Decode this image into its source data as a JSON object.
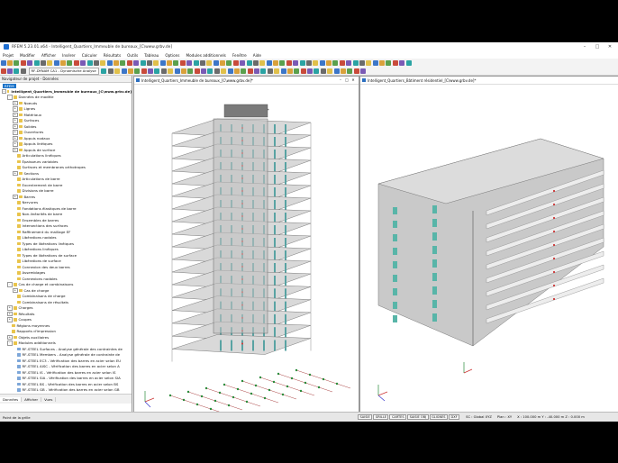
{
  "window": {
    "title": "RFEM 5.23.01.x64 - Intelligent_Quartiers_Immeuble de bureaux_[C\\www.grbv.de]",
    "controls": [
      "–",
      "□",
      "✕"
    ]
  },
  "menu": [
    "Projet",
    "Modifier",
    "Afficher",
    "Insérer",
    "Calculer",
    "Résultats",
    "Outils",
    "Tableau",
    "Options",
    "Modules additionnels",
    "Fenêtre",
    "Aide"
  ],
  "toolbar": {
    "load_case_combo": "RF-DYNAM CA1 - Dynamische Analyse",
    "colors": [
      "#3c76c8",
      "#d9a13b",
      "#5aa04d",
      "#c94b3b",
      "#7a5ab5",
      "#2aa3a3",
      "#6b6b6b",
      "#e0c04a"
    ]
  },
  "navigator": {
    "title": "Navigateur de projet - Données",
    "chip": "RFEM",
    "items": [
      {
        "depth": 0,
        "exp": "-",
        "label": "Intelligent_Quartiers_Immeuble de bureaux_[C\\www.grbv.de]",
        "bold": true
      },
      {
        "depth": 1,
        "exp": "-",
        "label": "Données de modèle"
      },
      {
        "depth": 2,
        "exp": "+",
        "label": "Noeuds"
      },
      {
        "depth": 2,
        "exp": "+",
        "label": "Lignes"
      },
      {
        "depth": 2,
        "exp": "+",
        "label": "Matériaux"
      },
      {
        "depth": 2,
        "exp": "+",
        "label": "Surfaces"
      },
      {
        "depth": 2,
        "exp": "+",
        "label": "Solides"
      },
      {
        "depth": 2,
        "exp": "+",
        "label": "Ouvertures"
      },
      {
        "depth": 2,
        "exp": "+",
        "label": "Appuis nodaux"
      },
      {
        "depth": 2,
        "exp": "+",
        "label": "Appuis linéiques"
      },
      {
        "depth": 2,
        "exp": "+",
        "label": "Appuis de surface"
      },
      {
        "depth": 2,
        "exp": "",
        "label": "Articulations linéiques"
      },
      {
        "depth": 2,
        "exp": "",
        "label": "Épaisseurs variables"
      },
      {
        "depth": 2,
        "exp": "",
        "label": "Surfaces et membranes orthotropes"
      },
      {
        "depth": 2,
        "exp": "+",
        "label": "Sections"
      },
      {
        "depth": 2,
        "exp": "",
        "label": "Articulations de barre"
      },
      {
        "depth": 2,
        "exp": "",
        "label": "Excentrement de barre"
      },
      {
        "depth": 2,
        "exp": "",
        "label": "Divisions de barre"
      },
      {
        "depth": 2,
        "exp": "+",
        "label": "Barres"
      },
      {
        "depth": 2,
        "exp": "",
        "label": "Nervures"
      },
      {
        "depth": 2,
        "exp": "",
        "label": "Fondations élastiques de barre"
      },
      {
        "depth": 2,
        "exp": "",
        "label": "Non-linéarités de barre"
      },
      {
        "depth": 2,
        "exp": "",
        "label": "Ensembles de barres"
      },
      {
        "depth": 2,
        "exp": "",
        "label": "Intersections des surfaces"
      },
      {
        "depth": 2,
        "exp": "",
        "label": "Raffinement du maillage EF"
      },
      {
        "depth": 2,
        "exp": "",
        "label": "Libérations nodales"
      },
      {
        "depth": 2,
        "exp": "",
        "label": "Types de libérations linéiques"
      },
      {
        "depth": 2,
        "exp": "",
        "label": "Libérations linéiques"
      },
      {
        "depth": 2,
        "exp": "",
        "label": "Types de libérations de surface"
      },
      {
        "depth": 2,
        "exp": "",
        "label": "Libérations de surface"
      },
      {
        "depth": 2,
        "exp": "",
        "label": "Connexion des deux barres"
      },
      {
        "depth": 2,
        "exp": "",
        "label": "Assemblages"
      },
      {
        "depth": 2,
        "exp": "",
        "label": "Connexions nodales"
      },
      {
        "depth": 1,
        "exp": "-",
        "label": "Cas de charge et combinaisons"
      },
      {
        "depth": 2,
        "exp": "+",
        "label": "Cas de charge"
      },
      {
        "depth": 2,
        "exp": "",
        "label": "Combinaisons de charge"
      },
      {
        "depth": 2,
        "exp": "",
        "label": "Combinaisons de résultats"
      },
      {
        "depth": 1,
        "exp": "+",
        "label": "Charges"
      },
      {
        "depth": 1,
        "exp": "+",
        "label": "Résultats"
      },
      {
        "depth": 1,
        "exp": "+",
        "label": "Coupes"
      },
      {
        "depth": 1,
        "exp": "",
        "label": "Régions moyennes"
      },
      {
        "depth": 1,
        "exp": "",
        "label": "Rapports d'impression"
      },
      {
        "depth": 1,
        "exp": "+",
        "label": "Objets auxiliaires"
      },
      {
        "depth": 1,
        "exp": "-",
        "label": "Modules additionnels"
      },
      {
        "depth": 2,
        "exp": "",
        "label": "RF-STEEL Surfaces - Analyse générale des contraintes de",
        "doc": true
      },
      {
        "depth": 2,
        "exp": "",
        "label": "RF-STEEL Members - Analyse générale de contrainte de",
        "doc": true
      },
      {
        "depth": 2,
        "exp": "",
        "label": "RF-STEEL EC3 - Vérification des barres en acier selon EU",
        "doc": true
      },
      {
        "depth": 2,
        "exp": "",
        "label": "RF-STEEL AISC - Vérification des barres en acier selon A",
        "doc": true
      },
      {
        "depth": 2,
        "exp": "",
        "label": "RF-STEEL IS - Vérification des barres en acier selon IS",
        "doc": true
      },
      {
        "depth": 2,
        "exp": "",
        "label": "RF-STEEL SIA - Vérification des barres en acier selon SIA",
        "doc": true
      },
      {
        "depth": 2,
        "exp": "",
        "label": "RF-STEEL BS - Vérification des barres en acier selon BS",
        "doc": true
      },
      {
        "depth": 2,
        "exp": "",
        "label": "RF-STEEL GB - Vérification des barres en acier selon GB",
        "doc": true
      },
      {
        "depth": 2,
        "exp": "",
        "label": "RF-STEEL CSA - Vérification des barres en acier selon C",
        "doc": true
      }
    ],
    "tabs": [
      "Données",
      "Afficher",
      "Vues"
    ]
  },
  "views": [
    {
      "title": "Intelligent_Quartiers_Immeuble de bureaux_[C\\www.grbv.de]*"
    },
    {
      "title": "Intelligent_Quartiers_Bâtiment résidentiel_[C\\www.grbv.de]*"
    }
  ],
  "statusbar": {
    "left": "Point de la grille",
    "tabs": [
      "SAISIE",
      "GRILLE",
      "CARTES",
      "SAISIE OBJ",
      "GLIGNES",
      "DXF"
    ],
    "sc": "SC : Global XYZ",
    "plan": "Plan : XY",
    "coords": "X : 100.000 m   Y : -40.000 m   Z : 0.000 m"
  }
}
